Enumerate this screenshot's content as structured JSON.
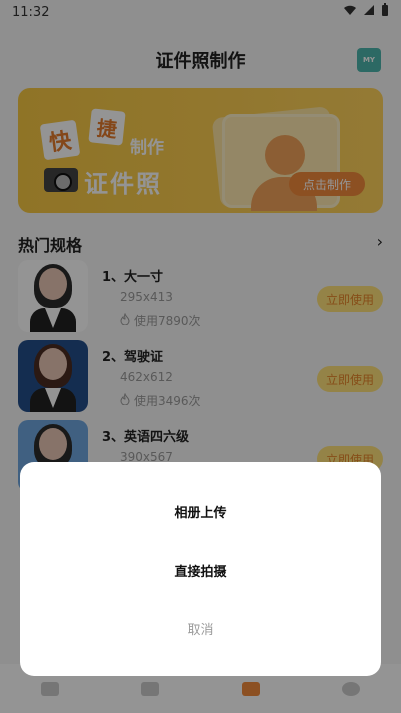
{
  "status_bar": {
    "time": "11:32"
  },
  "header": {
    "title": "证件照制作",
    "my_icon": "MY"
  },
  "banner": {
    "char_kuai": "快",
    "char_jie": "捷",
    "text_make": "制作",
    "text_idphoto": "证件照",
    "cta": "点击制作"
  },
  "section": {
    "title": "热门规格",
    "arrow": "›"
  },
  "items": [
    {
      "title": "1、大一寸",
      "size": "295x413",
      "uses": "使用7890次",
      "button": "立即使用"
    },
    {
      "title": "2、驾驶证",
      "size": "462x612",
      "uses": "使用3496次",
      "button": "立即使用"
    },
    {
      "title": "3、英语四六级",
      "size": "390x567",
      "uses": "",
      "button": "立即使用"
    }
  ],
  "modal": {
    "option_album": "相册上传",
    "option_camera": "直接拍摄",
    "option_cancel": "取消"
  },
  "icons": {
    "wifi": "wifi-icon",
    "signal": "signal-icon",
    "battery": "battery-icon",
    "flame": "flame-icon",
    "arrow_right": "chevron-right-icon"
  }
}
